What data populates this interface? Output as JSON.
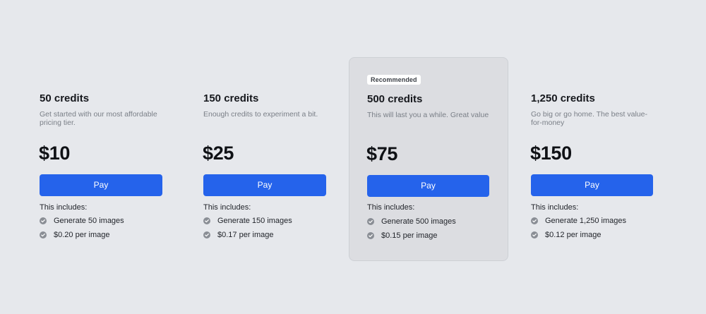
{
  "plans": [
    {
      "title": "50 credits",
      "description": "Get started with our most affordable pricing tier.",
      "price": "$10",
      "pay_label": "Pay",
      "includes_label": "This includes:",
      "features": [
        "Generate 50 images",
        "$0.20 per image"
      ],
      "featured": false
    },
    {
      "title": "150 credits",
      "description": "Enough credits to experiment a bit.",
      "price": "$25",
      "pay_label": "Pay",
      "includes_label": "This includes:",
      "features": [
        "Generate 150 images",
        "$0.17 per image"
      ],
      "featured": false
    },
    {
      "badge": "Recommended",
      "title": "500 credits",
      "description": "This will last you a while. Great value",
      "price": "$75",
      "pay_label": "Pay",
      "includes_label": "This includes:",
      "features": [
        "Generate 500 images",
        "$0.15 per image"
      ],
      "featured": true
    },
    {
      "title": "1,250 credits",
      "description": "Go big or go home. The best value-for-money",
      "price": "$150",
      "pay_label": "Pay",
      "includes_label": "This includes:",
      "features": [
        "Generate 1,250 images",
        "$0.12 per image"
      ],
      "featured": false
    }
  ],
  "colors": {
    "background": "#e6e8ec",
    "featured_card": "#dcdde1",
    "button": "#2563eb",
    "check_icon": "#8a8e95"
  },
  "icons": {
    "feature": "check-circle-icon"
  }
}
